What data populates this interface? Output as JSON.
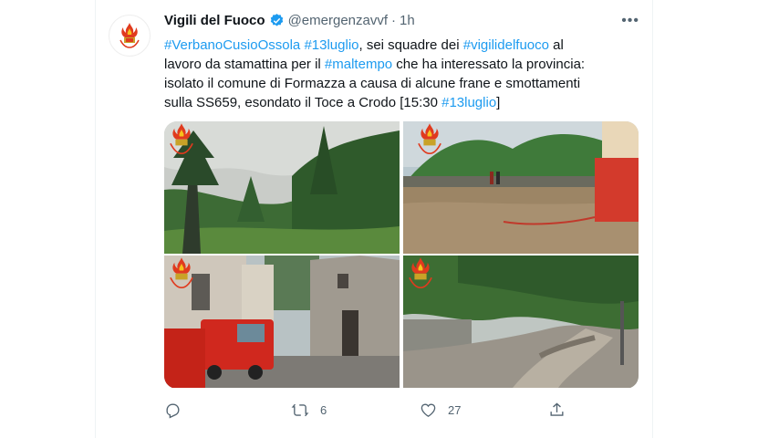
{
  "tweet": {
    "author_name": "Vigili del Fuoco",
    "handle": "@emergenzavvf",
    "separator": "·",
    "time": "1h",
    "more_label": "•••",
    "text_parts": [
      {
        "t": "#VerbanoCusioOssola",
        "hl": true
      },
      {
        "t": " ",
        "hl": false
      },
      {
        "t": "#13luglio",
        "hl": true
      },
      {
        "t": ", sei squadre dei ",
        "hl": false
      },
      {
        "t": "#vigilidelfuoco",
        "hl": true
      },
      {
        "t": " al lavoro da stamattina per il ",
        "hl": false
      },
      {
        "t": "#maltempo",
        "hl": true
      },
      {
        "t": " che ha interessato la provincia: isolato il comune di Formazza a causa di alcune frane e smottamenti sulla SS659, esondato il Toce a Crodo [15:30 ",
        "hl": false
      },
      {
        "t": "#13luglio",
        "hl": true
      },
      {
        "t": "]",
        "hl": false
      }
    ],
    "photos": [
      {
        "desc": "forest-valley"
      },
      {
        "desc": "flooded-street"
      },
      {
        "desc": "fire-truck-village"
      },
      {
        "desc": "landslide-road"
      }
    ],
    "actions": {
      "reply": {
        "icon": "reply-icon",
        "count": ""
      },
      "retweet": {
        "icon": "retweet-icon",
        "count": "6"
      },
      "like": {
        "icon": "heart-icon",
        "count": "27"
      },
      "share": {
        "icon": "share-icon",
        "count": ""
      }
    }
  },
  "colors": {
    "link": "#1d9bf0",
    "muted": "#536471",
    "verified": "#1d9bf0"
  }
}
